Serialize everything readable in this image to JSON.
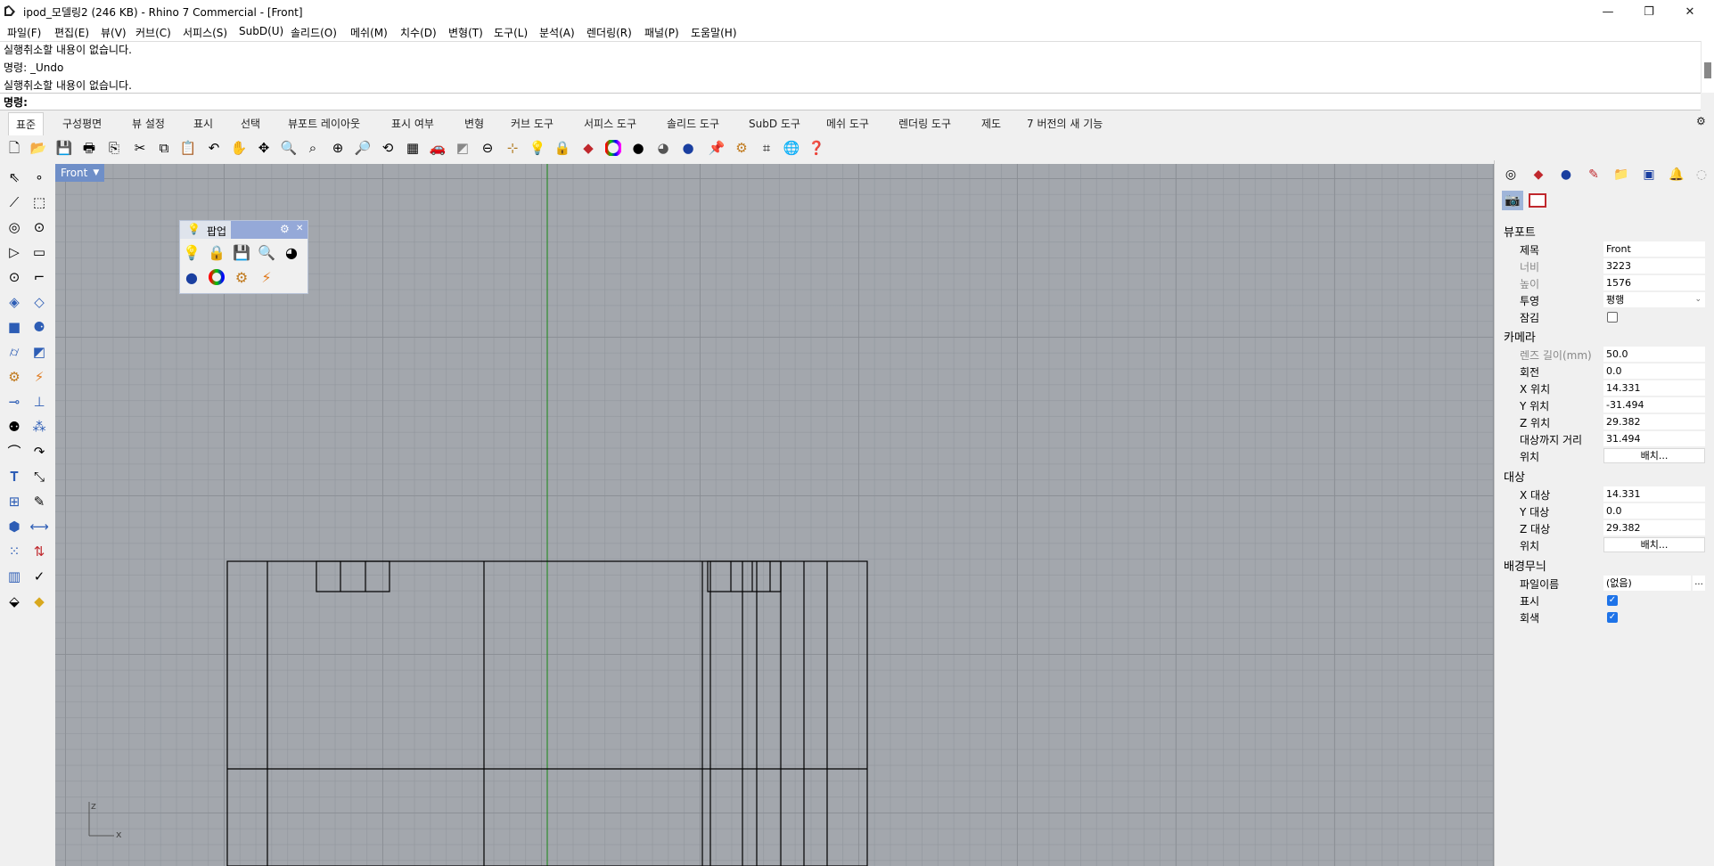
{
  "window": {
    "title": "ipod_모델링2 (246 KB) - Rhino 7 Commercial - [Front]",
    "controls": {
      "minimize": "—",
      "restore": "❐",
      "close": "✕"
    }
  },
  "menu": [
    "파일(F)",
    "편집(E)",
    "뷰(V)",
    "커브(C)",
    "서피스(S)",
    "SubD(U)",
    "솔리드(O)",
    "메쉬(M)",
    "치수(D)",
    "변형(T)",
    "도구(L)",
    "분석(A)",
    "렌더링(R)",
    "패널(P)",
    "도움말(H)"
  ],
  "command_history": [
    "실행취소할 내용이 없습니다.",
    "명령: _Undo",
    "실행취소할 내용이 없습니다."
  ],
  "command_prompt": {
    "label": "명령:",
    "value": ""
  },
  "tabs": [
    "표준",
    "구성평면",
    "뷰 설정",
    "표시",
    "선택",
    "뷰포트 레이아웃",
    "표시 여부",
    "변형",
    "커브 도구",
    "서피스 도구",
    "솔리드 도구",
    "SubD 도구",
    "메쉬 도구",
    "렌더링 도구",
    "제도",
    "7 버전의 새 기능"
  ],
  "active_tab": "표준",
  "toolbar_icons": [
    "new-icon",
    "open-icon",
    "save-icon",
    "print-icon",
    "import-icon",
    "cut-icon",
    "copy-icon",
    "paste-icon",
    "undo-icon",
    "pan-icon",
    "rotate-view-icon",
    "zoom-icon",
    "zoom-window-icon",
    "zoom-extents-icon",
    "zoom-selected-icon",
    "undo-view-icon",
    "four-viewports-icon",
    "car-icon",
    "named-cplane-icon",
    "osnap-icon",
    "grid-snap-icon",
    "light-icon",
    "lock-icon",
    "material-icon",
    "color-wheel-icon",
    "shade-icon",
    "render-preview-icon",
    "render-icon",
    "pin-icon",
    "settings-icon",
    "dimension-icon",
    "world-icon",
    "help-icon"
  ],
  "viewport": {
    "name": "Front",
    "axis_z": "z",
    "axis_x": "x",
    "grid_color": "#8c9198",
    "background": "#a3a7ad"
  },
  "popup": {
    "title": "팝업",
    "icons": [
      "light-icon",
      "lock-icon",
      "save-icon",
      "zoom-icon",
      "shade-icon",
      "render-icon",
      "color-wheel-icon",
      "settings-icon",
      "render-preview-icon"
    ]
  },
  "right_panel": {
    "tab_icons": [
      "properties-icon",
      "layers-icon",
      "render-icon",
      "brush-icon",
      "folder-icon",
      "display-icon",
      "notification-icon",
      "help-icon"
    ],
    "viewport_section": {
      "heading": "뷰포트",
      "rows": [
        {
          "label": "제목",
          "value": "Front"
        },
        {
          "label": "너비",
          "value": "3223"
        },
        {
          "label": "높이",
          "value": "1576"
        },
        {
          "label": "투영",
          "value": "평행"
        },
        {
          "label": "잠김",
          "value": ""
        }
      ]
    },
    "camera_section": {
      "heading": "카메라",
      "rows": [
        {
          "label": "렌즈 길이(mm)",
          "value": "50.0"
        },
        {
          "label": "회전",
          "value": "0.0"
        },
        {
          "label": "X 위치",
          "value": "14.331"
        },
        {
          "label": "Y 위치",
          "value": "-31.494"
        },
        {
          "label": "Z 위치",
          "value": "29.382"
        },
        {
          "label": "대상까지 거리",
          "value": "31.494"
        },
        {
          "label": "위치",
          "button": "배치..."
        }
      ]
    },
    "target_section": {
      "heading": "대상",
      "rows": [
        {
          "label": "X 대상",
          "value": "14.331"
        },
        {
          "label": "Y 대상",
          "value": "0.0"
        },
        {
          "label": "Z 대상",
          "value": "29.382"
        },
        {
          "label": "위치",
          "button": "배치..."
        }
      ]
    },
    "wallpaper_section": {
      "heading": "배경무늬",
      "rows": [
        {
          "label": "파일이름",
          "value": "(없음)",
          "extra": "..."
        },
        {
          "label": "표시",
          "checked": true
        },
        {
          "label": "회색",
          "checked": true
        }
      ]
    }
  },
  "colors": {
    "accent": "#1e73e8",
    "viewport_label": "#6f8fc8",
    "geometry": "#000000",
    "axis_line": "#2f8a2f"
  }
}
